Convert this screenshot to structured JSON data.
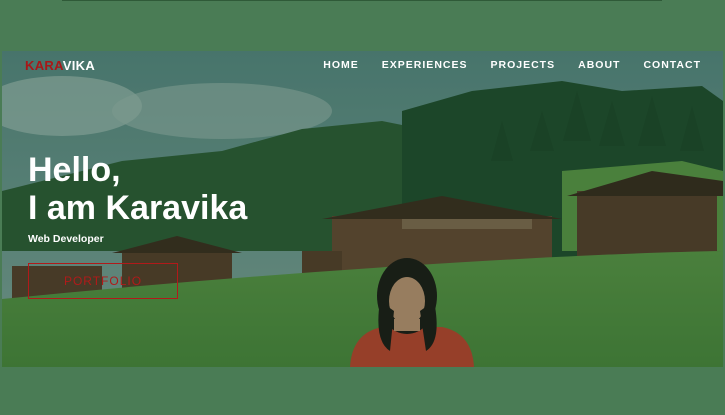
{
  "brand": {
    "part1": "KARA",
    "part2": "VIKA"
  },
  "nav": {
    "items": [
      {
        "label": "HOME"
      },
      {
        "label": "EXPERIENCES"
      },
      {
        "label": "PROJECTS"
      },
      {
        "label": "ABOUT"
      },
      {
        "label": "CONTACT"
      }
    ]
  },
  "hero": {
    "greeting_line1": "Hello,",
    "greeting_line2": "I am Karavika",
    "role": "Web Developer",
    "cta_label": "PORTFOLIO"
  },
  "colors": {
    "page_bg": "#4a7c55",
    "accent_red": "#a81818",
    "text": "#ffffff"
  }
}
